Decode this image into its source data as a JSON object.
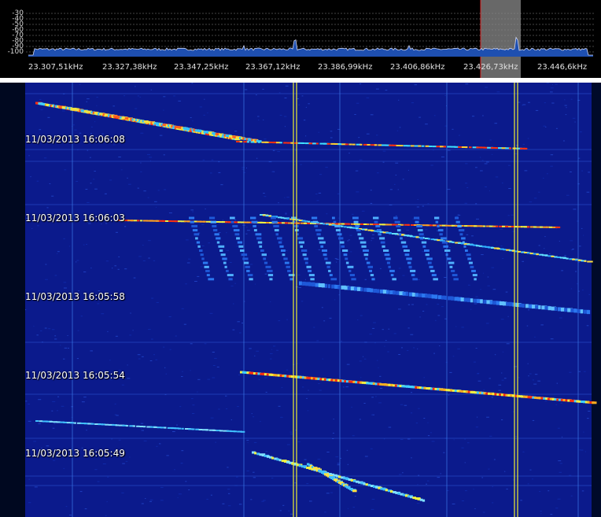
{
  "spectrum": {
    "db_scale": [
      "-30",
      "-40",
      "-50",
      "-60",
      "-70",
      "-80",
      "-90",
      "-100"
    ],
    "frequency_labels": [
      "23.307,51kHz",
      "23.327,38kHz",
      "23.347,25kHz",
      "23.367,12kHz",
      "23.386,99kHz",
      "23.406,86kHz",
      "23.426,73kHz",
      "23.446,6kHz"
    ],
    "selection_color": "#7a7a7a",
    "cursor_color": "#e03030",
    "trace_color": "#d0d6f0",
    "fill_color": "#1e4fb0"
  },
  "waterfall": {
    "timestamps": [
      "11/03/2013 16:06:08",
      "11/03/2013 16:06:03",
      "11/03/2013 16:05:58",
      "11/03/2013 16:05:54",
      "11/03/2013 16:05:49"
    ],
    "background_color": "#0b1a8c",
    "marker_color": "#f0f030"
  }
}
